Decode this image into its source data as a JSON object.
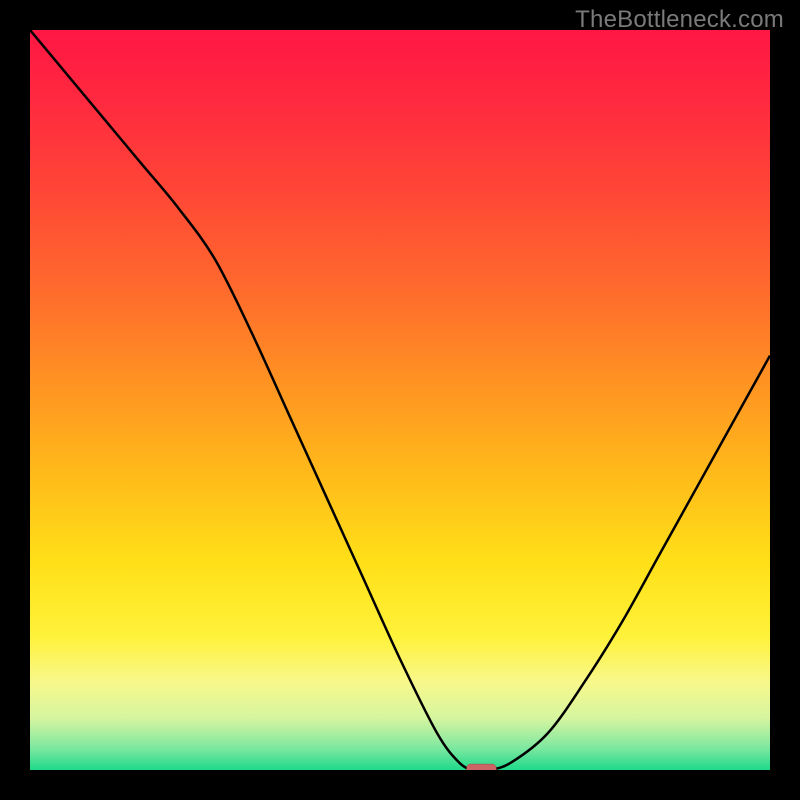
{
  "watermark": "TheBottleneck.com",
  "chart_data": {
    "type": "line",
    "title": "",
    "xlabel": "",
    "ylabel": "",
    "xlim": [
      0,
      100
    ],
    "ylim": [
      0,
      100
    ],
    "grid": false,
    "legend": false,
    "series": [
      {
        "name": "bottleneck-curve",
        "x": [
          0,
          5,
          10,
          15,
          20,
          25,
          30,
          35,
          40,
          45,
          50,
          55,
          58,
          60,
          62,
          65,
          70,
          75,
          80,
          85,
          90,
          95,
          100
        ],
        "y": [
          100,
          94,
          88,
          82,
          76,
          69,
          59,
          48,
          37,
          26,
          15,
          5,
          1,
          0,
          0,
          1,
          5,
          12,
          20,
          29,
          38,
          47,
          56
        ]
      }
    ],
    "marker": {
      "x": 61,
      "y": 0,
      "width": 4,
      "height": 1.6
    },
    "background_gradient": {
      "stops": [
        {
          "offset": 0.0,
          "color": "#ff1744"
        },
        {
          "offset": 0.1,
          "color": "#ff2a3f"
        },
        {
          "offset": 0.22,
          "color": "#ff4736"
        },
        {
          "offset": 0.35,
          "color": "#ff6a2d"
        },
        {
          "offset": 0.48,
          "color": "#ff9422"
        },
        {
          "offset": 0.6,
          "color": "#ffba1a"
        },
        {
          "offset": 0.72,
          "color": "#ffe018"
        },
        {
          "offset": 0.82,
          "color": "#fff23a"
        },
        {
          "offset": 0.88,
          "color": "#f8f88a"
        },
        {
          "offset": 0.93,
          "color": "#d6f5a0"
        },
        {
          "offset": 0.97,
          "color": "#7ee8a0"
        },
        {
          "offset": 1.0,
          "color": "#1fd98b"
        }
      ]
    }
  }
}
